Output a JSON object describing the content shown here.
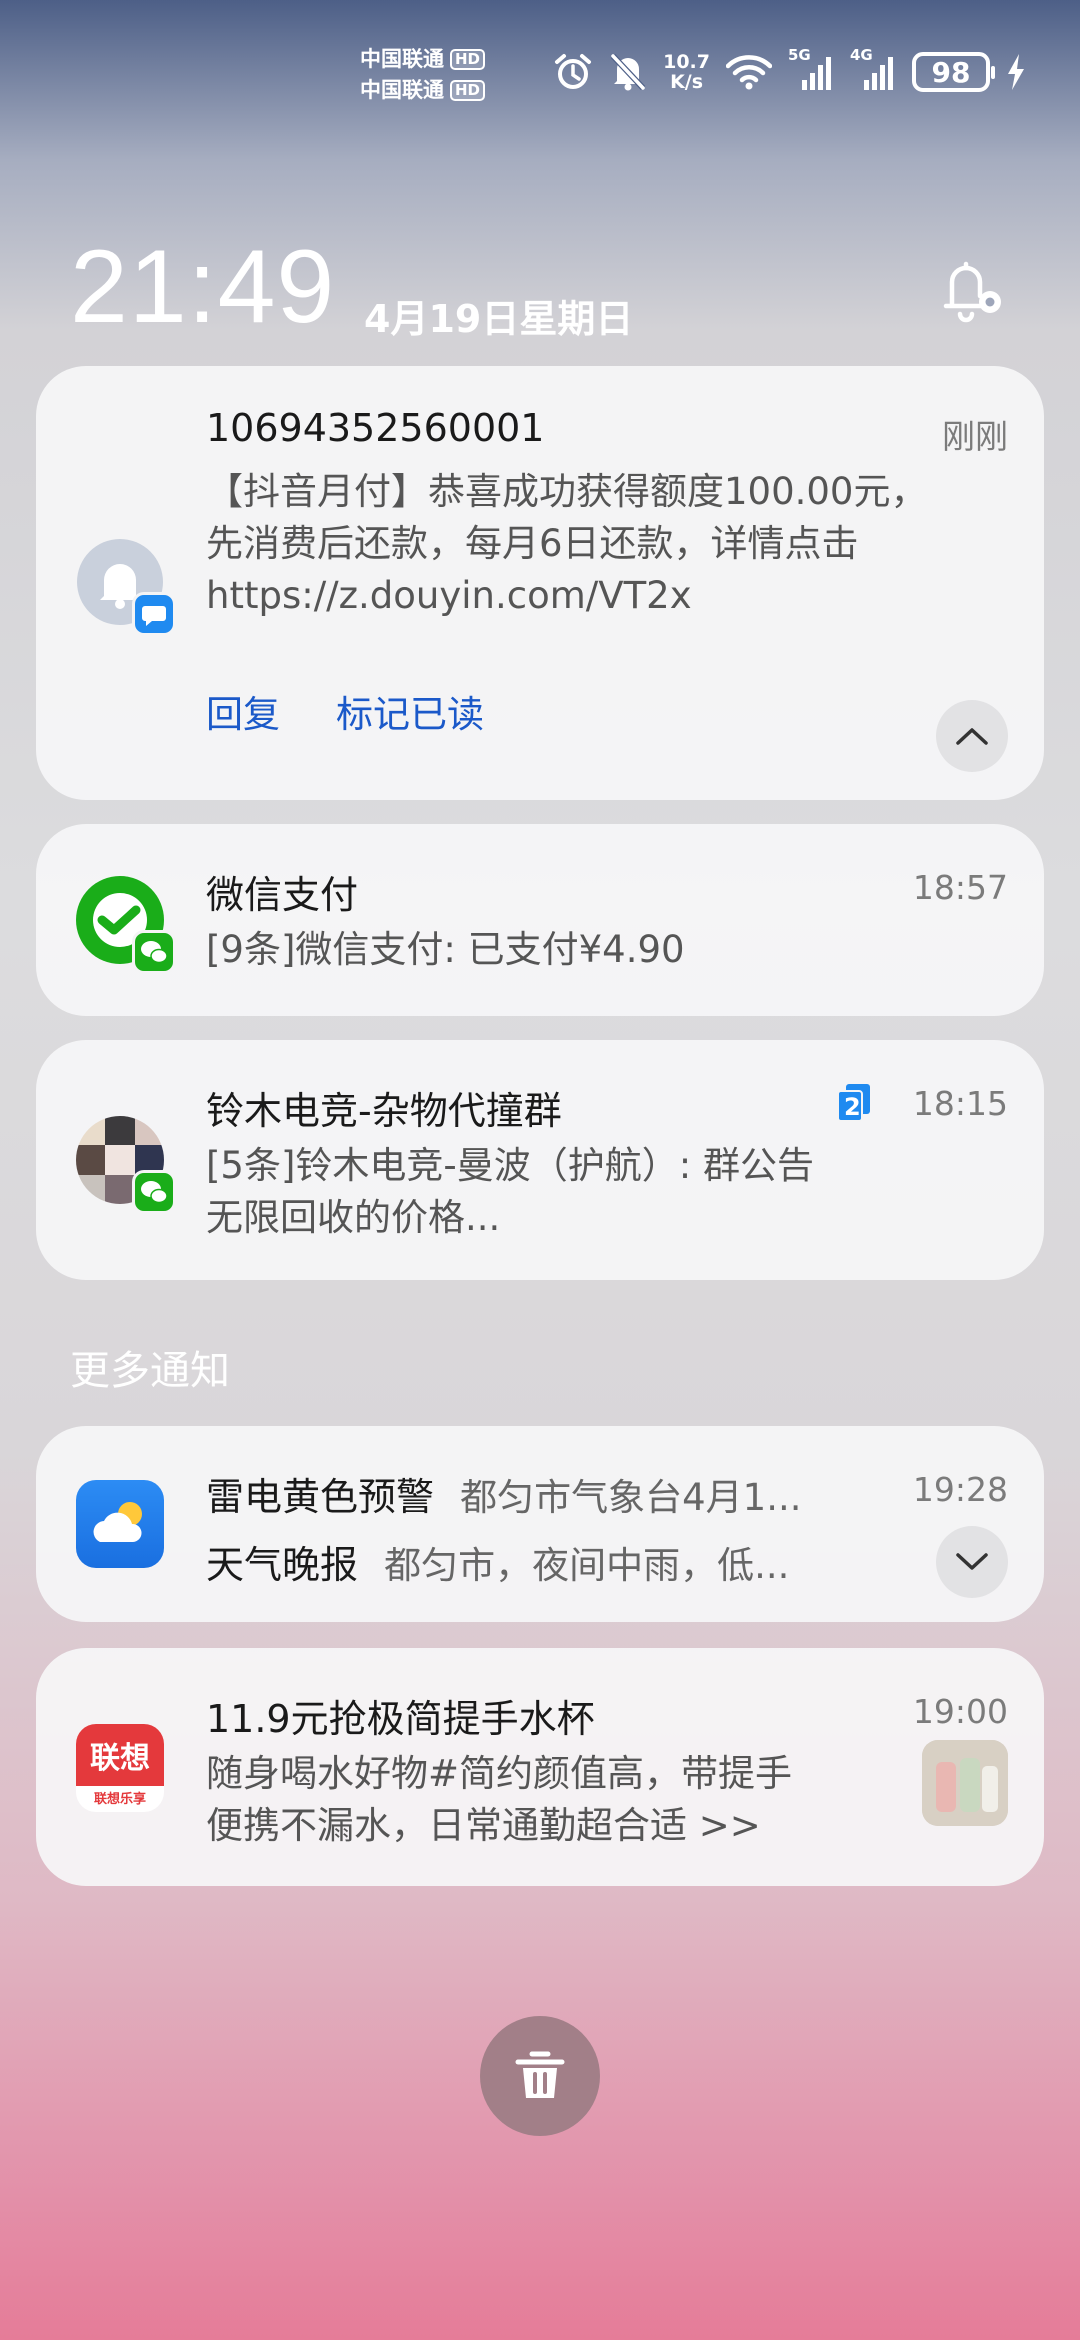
{
  "status_bar": {
    "carrier1": "中国联通",
    "carrier2": "中国联通",
    "hd_label": "HD",
    "speed_value": "10.7",
    "speed_unit": "K/s",
    "signal1_label": "5G",
    "signal2_label": "4G",
    "battery": "98",
    "icons": [
      "alarm-icon",
      "mute-icon",
      "wifi-icon",
      "signal-icon",
      "charging-icon"
    ]
  },
  "clock": {
    "time": "21:49",
    "date": "4月19日星期日"
  },
  "notifications": [
    {
      "sender": "10694352560001",
      "time": "刚刚",
      "body": "【抖音月付】恭喜成功获得额度100.00元，先消费后还款，每月6日还款，详情点击https://z.douyin.com/VT2x",
      "body_line1": "【抖音月付】恭喜成功获得额度100.00元，",
      "body_line2": "先消费后还款，每月6日还款，详情点击",
      "body_line3": "https://z.douyin.com/VT2x",
      "action_reply": "回复",
      "action_mark_read": "标记已读"
    },
    {
      "title": "微信支付",
      "time": "18:57",
      "body": "[9条]微信支付: 已支付¥4.90"
    },
    {
      "title": "铃木电竞-杂物代撞群",
      "time": "18:15",
      "badge": "2",
      "body_line1": "[5条]铃木电竞-曼波（护航）: 群公告",
      "body_line2": "无限回收的价格..."
    }
  ],
  "more_section_label": "更多通知",
  "more_notifications": [
    {
      "title1": "雷电黄色预警",
      "body1": "都匀市气象台4月1...",
      "title2": "天气晚报",
      "body2": "都匀市，夜间中雨，低...",
      "time": "19:28"
    },
    {
      "title": "11.9元抢极简提手水杯",
      "time": "19:00",
      "body_line1": "随身喝水好物#简约颜值高，带提手",
      "body_line2": "便携不漏水，日常通勤超合适 >>",
      "app_logo_text": "联想",
      "app_logo_sub": "联想乐享"
    }
  ],
  "colors": {
    "link": "#1b59c9",
    "wechat_green": "#1aad19",
    "weather_blue": "#1f8af0",
    "lenovo_red": "#e4393c"
  }
}
